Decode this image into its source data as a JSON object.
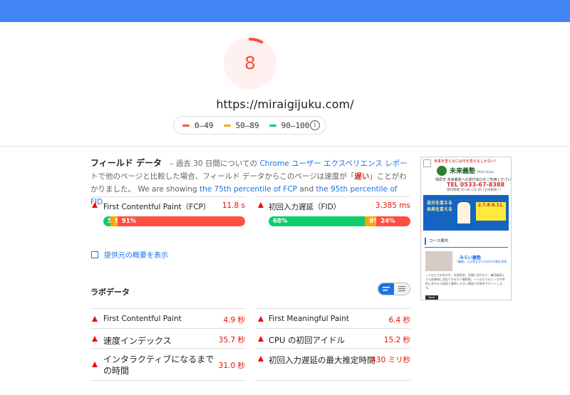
{
  "score": {
    "value": "8",
    "fraction": 0.08,
    "color": "#ff4e42"
  },
  "url": "https://miraigijuku.com/",
  "legend": {
    "items": [
      {
        "label": "0–49",
        "color": "#ff4e42"
      },
      {
        "label": "50–89",
        "color": "#ffa400"
      },
      {
        "label": "90–100",
        "color": "#0cce6b"
      }
    ],
    "info_icon": "info-icon",
    "info_glyph": "i"
  },
  "field": {
    "title": "フィールド データ",
    "desc_1": "– 過去 30 日間についての",
    "desc_link": "Chrome ユーザー エクスペリエンス レポート",
    "desc_2": "で他のページと比較した場合、フィールド データからこのページは速度が「",
    "desc_slow": "遅い",
    "desc_3": "」ことがわかりました。 We are showing",
    "desc_link2": "the 75th percentile of FCP",
    "desc_4": "and",
    "desc_link3": "the 95th percentile of FID",
    "desc_5": ".",
    "metrics": [
      {
        "name": "First Contentful Paint（FCP）",
        "value": "11.8 s",
        "dist": [
          {
            "label": "5%",
            "pct": 5
          },
          {
            "label": "5%",
            "pct": 5
          },
          {
            "label": "91%",
            "pct": 91
          }
        ]
      },
      {
        "name": "初回入力遅延（FID）",
        "value": "3,385 ms",
        "dist": [
          {
            "label": "68%",
            "pct": 68
          },
          {
            "label": "8%",
            "pct": 8
          },
          {
            "label": "24%",
            "pct": 24
          }
        ]
      }
    ],
    "origin_link": "提供元の概要を表示"
  },
  "lab": {
    "title": "ラボデータ",
    "metrics_left": [
      {
        "name": "First Contentful Paint",
        "value": "4.9 秒"
      },
      {
        "name": "速度インデックス",
        "value": "35.7 秒"
      },
      {
        "name": "インタラクティブになるまでの時間",
        "value": "31.0 秒"
      }
    ],
    "metrics_right": [
      {
        "name": "First Meaningful Paint",
        "value": "6.4 秒"
      },
      {
        "name": "CPU の初回アイドル",
        "value": "15.2 秒"
      },
      {
        "name": "初回入力遅延の最大推定時間",
        "value": "430 ミリ秒"
      }
    ]
  },
  "thumbnail": {
    "tagline": "未来を変えるには今を変えるしかない！",
    "brand": "未来義塾",
    "brand_en": "Mirai Gijuku",
    "sub": "塚原市 未来義塾への受付窓口をご利用ください",
    "tel": "TEL 0533-67-8388",
    "hours": "受付時間 10:30~21:30 (土日祝除く)",
    "banner_1": "自分を変える",
    "banner_2": "未来を変える",
    "dates": "2.7.8.9.11.",
    "course": "コース案内",
    "course_title": "みらい義塾",
    "course_sub": "「義塾」とは昔ながらの学びの場を表現",
    "course_text": "一人ひとりの学力や、学習目的、目標に合わせて、集団指導よりも効果的に対応できる少人数指導。一人ひとりのニーズや特性に合わせた指導と質問しやすい環境で学習をサポートします。",
    "more": "More"
  }
}
